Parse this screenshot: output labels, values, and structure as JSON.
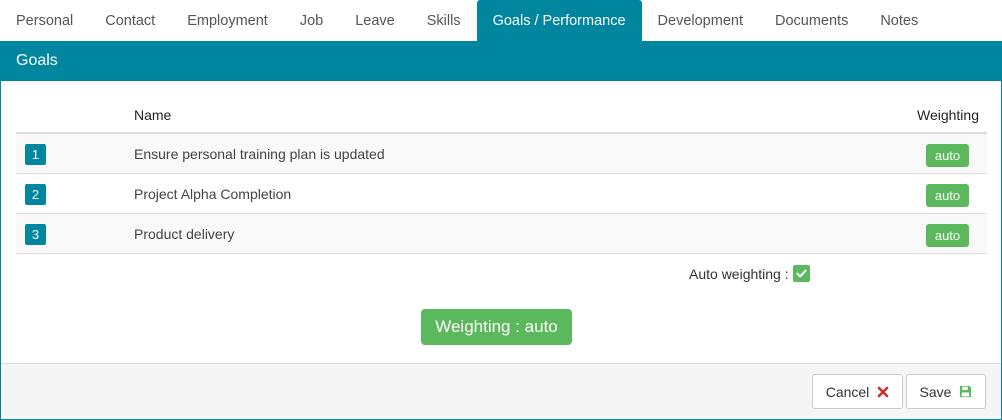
{
  "tabs": [
    {
      "label": "Personal"
    },
    {
      "label": "Contact"
    },
    {
      "label": "Employment"
    },
    {
      "label": "Job"
    },
    {
      "label": "Leave"
    },
    {
      "label": "Skills"
    },
    {
      "label": "Goals / Performance",
      "active": true
    },
    {
      "label": "Development"
    },
    {
      "label": "Documents"
    },
    {
      "label": "Notes"
    }
  ],
  "panel": {
    "title": "Goals",
    "table": {
      "headers": {
        "name": "Name",
        "weighting": "Weighting"
      },
      "rows": [
        {
          "num": "1",
          "name": "Ensure personal training plan is updated",
          "weighting": "auto"
        },
        {
          "num": "2",
          "name": "Project Alpha Completion",
          "weighting": "auto"
        },
        {
          "num": "3",
          "name": "Product delivery",
          "weighting": "auto"
        }
      ]
    },
    "auto_weighting": {
      "label": "Auto weighting :",
      "checked": true
    },
    "weighting_button": "Weighting : auto"
  },
  "footer": {
    "cancel_label": "Cancel",
    "save_label": "Save"
  },
  "colors": {
    "accent": "#00869e",
    "success": "#5cb85c",
    "danger": "#c9302c"
  }
}
